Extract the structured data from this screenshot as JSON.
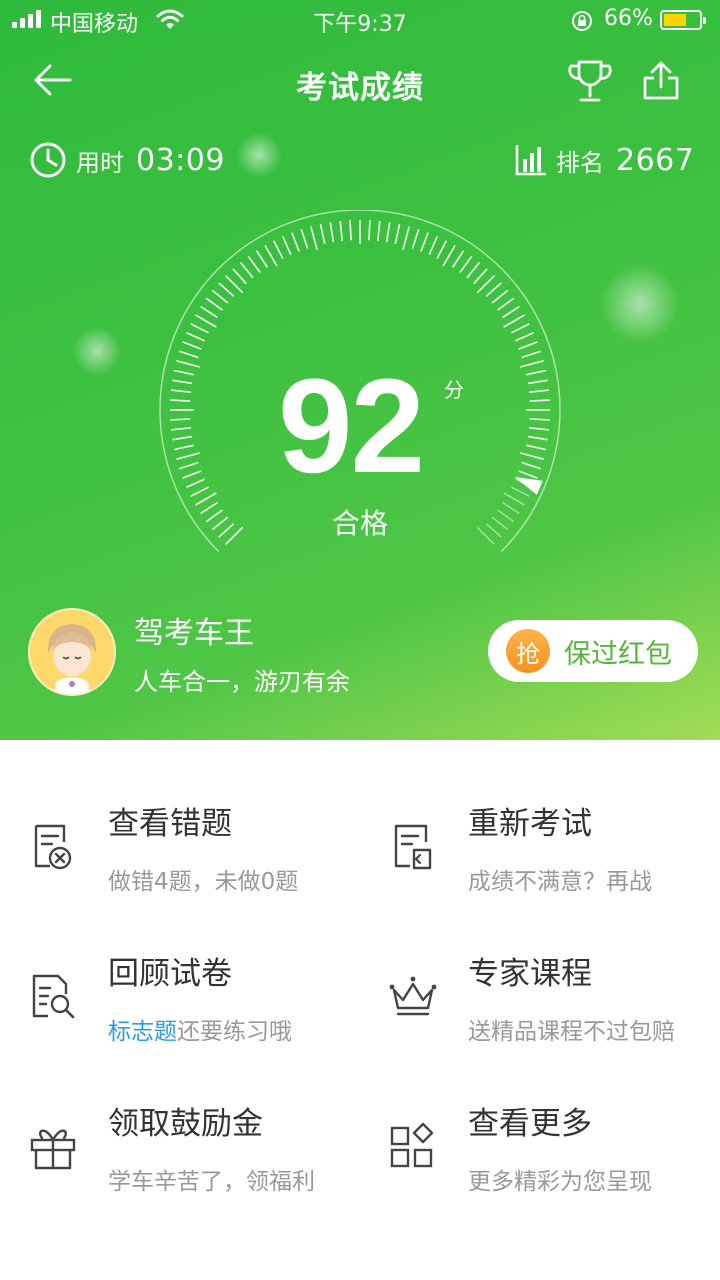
{
  "status_bar": {
    "carrier": "中国移动",
    "time": "下午9:37",
    "battery_percent": "66%",
    "battery_level": 0.66
  },
  "nav": {
    "title": "考试成绩",
    "back_icon": "arrow-left-icon",
    "trophy_icon": "trophy-icon",
    "share_icon": "share-icon"
  },
  "stats": {
    "time_label": "用时",
    "time_value": "03:09",
    "rank_label": "排名",
    "rank_value": "2667"
  },
  "score": {
    "value": "92",
    "unit": "分",
    "status": "合格",
    "gauge_level": 0.92
  },
  "profile": {
    "name": "驾考车王",
    "motto": "人车合一，游刃有余"
  },
  "reward": {
    "badge": "抢",
    "label": "保过红包"
  },
  "actions": [
    {
      "title": "查看错题",
      "subtitle": "做错4题，未做0题",
      "icon": "wrong-questions-icon"
    },
    {
      "title": "重新考试",
      "subtitle": "成绩不满意？再战",
      "icon": "retake-exam-icon"
    },
    {
      "title": "回顾试卷",
      "subtitle_highlight": "标志题",
      "subtitle": "还要练习哦",
      "icon": "review-paper-icon"
    },
    {
      "title": "专家课程",
      "subtitle": "送精品课程不过包赔",
      "icon": "crown-icon"
    },
    {
      "title": "领取鼓励金",
      "subtitle": "学车辛苦了，领福利",
      "icon": "gift-icon"
    },
    {
      "title": "查看更多",
      "subtitle": "更多精彩为您呈现",
      "icon": "more-apps-icon"
    }
  ],
  "colors": {
    "hero_start": "#2fba3c",
    "hero_end": "#a2dc55",
    "reward_text": "#56b53a",
    "reward_badge": "#f3921e",
    "highlight": "#2f9be0"
  }
}
